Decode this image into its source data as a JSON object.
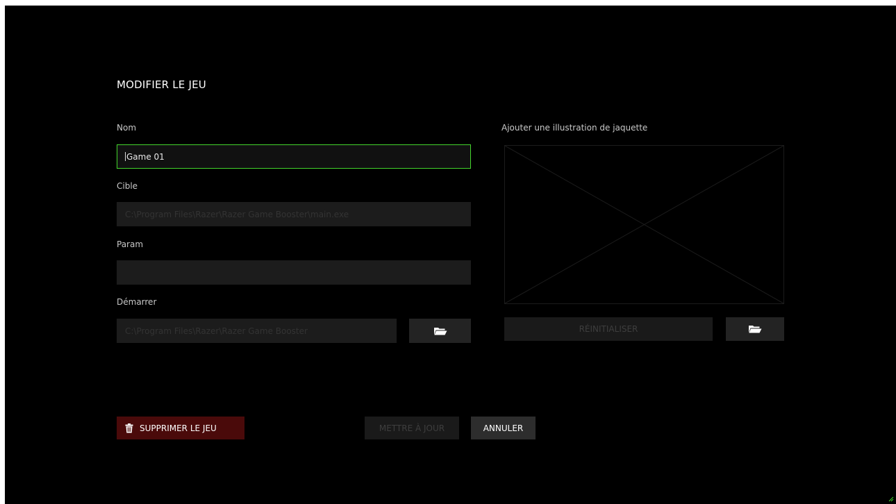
{
  "dialog": {
    "title": "MODIFIER LE JEU"
  },
  "form": {
    "name_label": "Nom",
    "name_value": "Game 01",
    "target_label": "Cible",
    "target_value": "C:\\Program Files\\Razer\\Razer Game Booster\\main.exe",
    "param_label": "Param",
    "param_value": "",
    "start_label": "Démarrer",
    "start_value": "C:\\Program Files\\Razer\\Razer Game Booster"
  },
  "artwork": {
    "label": "Ajouter une illustration de jaquette",
    "reset_label": "RÉINITIALISER"
  },
  "actions": {
    "delete_label": "SUPPRIMER LE JEU",
    "update_label": "METTRE À JOUR",
    "cancel_label": "ANNULER"
  },
  "icons": {
    "folder": "folder-open-icon",
    "trash": "trash-icon",
    "resize": "resize-grip-icon"
  },
  "colors": {
    "accent": "#44d62c",
    "delete_bg": "#4a0a0a",
    "background": "#000000"
  }
}
